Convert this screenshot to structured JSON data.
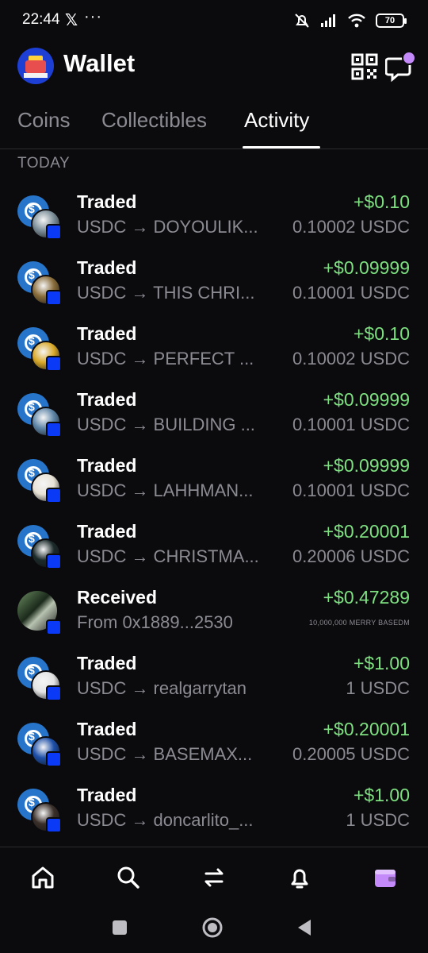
{
  "status_bar": {
    "time": "22:44",
    "x_glyph": "𝕏",
    "dots": "···",
    "battery": "70"
  },
  "header": {
    "title": "Wallet"
  },
  "tabs": [
    {
      "label": "Coins",
      "active": false
    },
    {
      "label": "Collectibles",
      "active": false
    },
    {
      "label": "Activity",
      "active": true
    }
  ],
  "section_label": "TODAY",
  "activity": [
    {
      "title": "Traded",
      "subtitle": "USDC → DOYOULIK...",
      "amount": "+$0.10",
      "value": "0.10002 USDC",
      "icon": "usdc-to-nft-icon",
      "nft_color": "#7d8f9a"
    },
    {
      "title": "Traded",
      "subtitle": "USDC → THIS CHRI...",
      "amount": "+$0.09999",
      "value": "0.10001 USDC",
      "icon": "usdc-to-nft-icon",
      "nft_color": "#8a6d3b"
    },
    {
      "title": "Traded",
      "subtitle": "USDC → PERFECT ...",
      "amount": "+$0.10",
      "value": "0.10002 USDC",
      "icon": "usdc-to-nft-icon",
      "nft_color": "#d9a92a"
    },
    {
      "title": "Traded",
      "subtitle": "USDC → BUILDING ...",
      "amount": "+$0.09999",
      "value": "0.10001 USDC",
      "icon": "usdc-to-nft-icon",
      "nft_color": "#5f86a8"
    },
    {
      "title": "Traded",
      "subtitle": "USDC → LAHHMAN...",
      "amount": "+$0.09999",
      "value": "0.10001 USDC",
      "icon": "usdc-to-nft-icon",
      "nft_color": "#e8e2d6"
    },
    {
      "title": "Traded",
      "subtitle": "USDC → CHRISTMA...",
      "amount": "+$0.20001",
      "value": "0.20006 USDC",
      "icon": "usdc-to-nft-icon",
      "nft_color": "#1c2a2a"
    },
    {
      "title": "Received",
      "subtitle": "From 0x1889...2530",
      "amount": "+$0.47289",
      "value": "10,000,000 MERRY BASEDM",
      "icon": "received-token-icon",
      "nft_color": "#3a4a36"
    },
    {
      "title": "Traded",
      "subtitle": "USDC → realgarrytan",
      "amount": "+$1.00",
      "value": "1 USDC",
      "icon": "usdc-to-nft-icon",
      "nft_color": "#e4e4e4"
    },
    {
      "title": "Traded",
      "subtitle": "USDC → BASEMAX...",
      "amount": "+$0.20001",
      "value": "0.20005 USDC",
      "icon": "usdc-to-nft-icon",
      "nft_color": "#1d4fa8"
    },
    {
      "title": "Traded",
      "subtitle": "USDC → doncarlito_...",
      "amount": "+$1.00",
      "value": "1 USDC",
      "icon": "usdc-to-nft-icon",
      "nft_color": "#3a2f2a"
    }
  ],
  "bottom_nav": [
    {
      "icon": "home-icon",
      "active": false
    },
    {
      "icon": "search-icon",
      "active": false
    },
    {
      "icon": "swap-icon",
      "active": false
    },
    {
      "icon": "bell-icon",
      "active": false
    },
    {
      "icon": "wallet-icon",
      "active": true,
      "accent": "#c58af9"
    }
  ],
  "colors": {
    "positive": "#7ee081",
    "muted": "#8b8b92",
    "accent": "#c58af9",
    "usdc": "#2775ca",
    "badge": "#0a3af5"
  }
}
